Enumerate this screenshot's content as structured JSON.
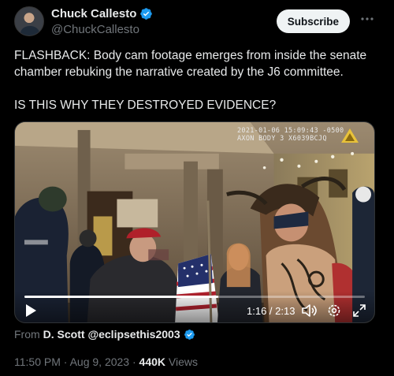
{
  "header": {
    "name": "Chuck Callesto",
    "handle": "@ChuckCallesto",
    "subscribe_label": "Subscribe"
  },
  "tweet": {
    "paragraphs": [
      "FLASHBACK: Body cam footage emerges from inside the senate chamber rebuking the narrative created by the J6 committee.",
      "IS THIS WHY THEY DESTROYED EVIDENCE?"
    ]
  },
  "video": {
    "overlay_line1": "2021-01-06 15:09:43 -0500",
    "overlay_line2": "AXON BODY 3 X6039BCJQ",
    "time_display": "1:16 / 2:13",
    "progress_fraction": 0.57
  },
  "attribution": {
    "from_label": "From",
    "from_name": "D. Scott @eclipsethis2003"
  },
  "meta": {
    "time": "11:50 PM",
    "separator": "·",
    "date": "Aug 9, 2023",
    "views_count": "440K",
    "views_label": "Views"
  },
  "colors": {
    "verified_badge": "#1d9bf0",
    "subscribe_bg": "#eff3f4",
    "muted_text": "#71767b",
    "primary_text": "#e7e9ea"
  },
  "icons": [
    "verified-badge-icon",
    "more-icon",
    "play-icon",
    "volume-icon",
    "settings-gear-icon",
    "fullscreen-icon",
    "axon-logo-icon"
  ]
}
